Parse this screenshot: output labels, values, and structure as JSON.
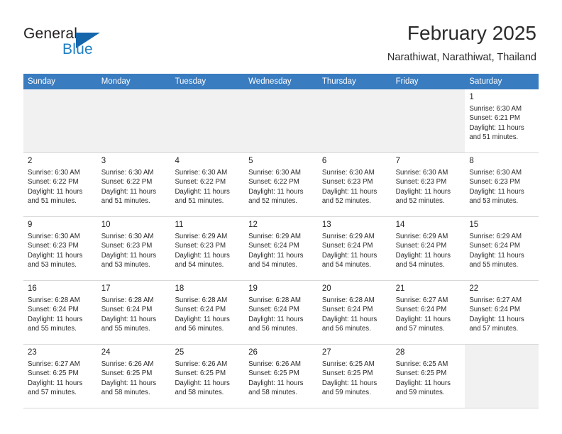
{
  "brand": {
    "name_part1": "General",
    "name_part2": "Blue",
    "accent_color": "#1566ab"
  },
  "header": {
    "title": "February 2025",
    "subtitle": "Narathiwat, Narathiwat, Thailand"
  },
  "weekdays": [
    "Sunday",
    "Monday",
    "Tuesday",
    "Wednesday",
    "Thursday",
    "Friday",
    "Saturday"
  ],
  "theme": {
    "header_row_bg": "#3a7cc0",
    "header_row_text": "#ffffff",
    "empty_cell_bg": "#f1f1f1",
    "day_number_bg": "#f1f1f1"
  },
  "weeks": [
    [
      {
        "empty": true
      },
      {
        "empty": true
      },
      {
        "empty": true
      },
      {
        "empty": true
      },
      {
        "empty": true
      },
      {
        "empty": true
      },
      {
        "day": "1",
        "sunrise": "Sunrise: 6:30 AM",
        "sunset": "Sunset: 6:21 PM",
        "daylight": "Daylight: 11 hours and 51 minutes."
      }
    ],
    [
      {
        "day": "2",
        "sunrise": "Sunrise: 6:30 AM",
        "sunset": "Sunset: 6:22 PM",
        "daylight": "Daylight: 11 hours and 51 minutes."
      },
      {
        "day": "3",
        "sunrise": "Sunrise: 6:30 AM",
        "sunset": "Sunset: 6:22 PM",
        "daylight": "Daylight: 11 hours and 51 minutes."
      },
      {
        "day": "4",
        "sunrise": "Sunrise: 6:30 AM",
        "sunset": "Sunset: 6:22 PM",
        "daylight": "Daylight: 11 hours and 51 minutes."
      },
      {
        "day": "5",
        "sunrise": "Sunrise: 6:30 AM",
        "sunset": "Sunset: 6:22 PM",
        "daylight": "Daylight: 11 hours and 52 minutes."
      },
      {
        "day": "6",
        "sunrise": "Sunrise: 6:30 AM",
        "sunset": "Sunset: 6:23 PM",
        "daylight": "Daylight: 11 hours and 52 minutes."
      },
      {
        "day": "7",
        "sunrise": "Sunrise: 6:30 AM",
        "sunset": "Sunset: 6:23 PM",
        "daylight": "Daylight: 11 hours and 52 minutes."
      },
      {
        "day": "8",
        "sunrise": "Sunrise: 6:30 AM",
        "sunset": "Sunset: 6:23 PM",
        "daylight": "Daylight: 11 hours and 53 minutes."
      }
    ],
    [
      {
        "day": "9",
        "sunrise": "Sunrise: 6:30 AM",
        "sunset": "Sunset: 6:23 PM",
        "daylight": "Daylight: 11 hours and 53 minutes."
      },
      {
        "day": "10",
        "sunrise": "Sunrise: 6:30 AM",
        "sunset": "Sunset: 6:23 PM",
        "daylight": "Daylight: 11 hours and 53 minutes."
      },
      {
        "day": "11",
        "sunrise": "Sunrise: 6:29 AM",
        "sunset": "Sunset: 6:23 PM",
        "daylight": "Daylight: 11 hours and 54 minutes."
      },
      {
        "day": "12",
        "sunrise": "Sunrise: 6:29 AM",
        "sunset": "Sunset: 6:24 PM",
        "daylight": "Daylight: 11 hours and 54 minutes."
      },
      {
        "day": "13",
        "sunrise": "Sunrise: 6:29 AM",
        "sunset": "Sunset: 6:24 PM",
        "daylight": "Daylight: 11 hours and 54 minutes."
      },
      {
        "day": "14",
        "sunrise": "Sunrise: 6:29 AM",
        "sunset": "Sunset: 6:24 PM",
        "daylight": "Daylight: 11 hours and 54 minutes."
      },
      {
        "day": "15",
        "sunrise": "Sunrise: 6:29 AM",
        "sunset": "Sunset: 6:24 PM",
        "daylight": "Daylight: 11 hours and 55 minutes."
      }
    ],
    [
      {
        "day": "16",
        "sunrise": "Sunrise: 6:28 AM",
        "sunset": "Sunset: 6:24 PM",
        "daylight": "Daylight: 11 hours and 55 minutes."
      },
      {
        "day": "17",
        "sunrise": "Sunrise: 6:28 AM",
        "sunset": "Sunset: 6:24 PM",
        "daylight": "Daylight: 11 hours and 55 minutes."
      },
      {
        "day": "18",
        "sunrise": "Sunrise: 6:28 AM",
        "sunset": "Sunset: 6:24 PM",
        "daylight": "Daylight: 11 hours and 56 minutes."
      },
      {
        "day": "19",
        "sunrise": "Sunrise: 6:28 AM",
        "sunset": "Sunset: 6:24 PM",
        "daylight": "Daylight: 11 hours and 56 minutes."
      },
      {
        "day": "20",
        "sunrise": "Sunrise: 6:28 AM",
        "sunset": "Sunset: 6:24 PM",
        "daylight": "Daylight: 11 hours and 56 minutes."
      },
      {
        "day": "21",
        "sunrise": "Sunrise: 6:27 AM",
        "sunset": "Sunset: 6:24 PM",
        "daylight": "Daylight: 11 hours and 57 minutes."
      },
      {
        "day": "22",
        "sunrise": "Sunrise: 6:27 AM",
        "sunset": "Sunset: 6:24 PM",
        "daylight": "Daylight: 11 hours and 57 minutes."
      }
    ],
    [
      {
        "day": "23",
        "sunrise": "Sunrise: 6:27 AM",
        "sunset": "Sunset: 6:25 PM",
        "daylight": "Daylight: 11 hours and 57 minutes."
      },
      {
        "day": "24",
        "sunrise": "Sunrise: 6:26 AM",
        "sunset": "Sunset: 6:25 PM",
        "daylight": "Daylight: 11 hours and 58 minutes."
      },
      {
        "day": "25",
        "sunrise": "Sunrise: 6:26 AM",
        "sunset": "Sunset: 6:25 PM",
        "daylight": "Daylight: 11 hours and 58 minutes."
      },
      {
        "day": "26",
        "sunrise": "Sunrise: 6:26 AM",
        "sunset": "Sunset: 6:25 PM",
        "daylight": "Daylight: 11 hours and 58 minutes."
      },
      {
        "day": "27",
        "sunrise": "Sunrise: 6:25 AM",
        "sunset": "Sunset: 6:25 PM",
        "daylight": "Daylight: 11 hours and 59 minutes."
      },
      {
        "day": "28",
        "sunrise": "Sunrise: 6:25 AM",
        "sunset": "Sunset: 6:25 PM",
        "daylight": "Daylight: 11 hours and 59 minutes."
      },
      {
        "empty": true
      }
    ]
  ]
}
